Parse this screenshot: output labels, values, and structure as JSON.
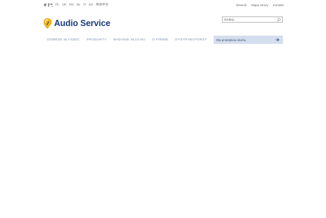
{
  "languages": [
    "PL",
    "UK",
    "EN",
    "NL",
    "IT",
    "ES",
    "简体中文"
  ],
  "util_links": {
    "slownik": "Słownik",
    "mapa": "Mapa strony",
    "kontakt": "Kontakt"
  },
  "logo": {
    "text": "Audio Service"
  },
  "search": {
    "placeholder": "Szukaj..."
  },
  "nav": {
    "items": [
      "DOBRZE SŁYSZEĆ",
      "PRODUKTY",
      "BADANIE SŁUCHU",
      "O FIRMIE",
      "DYSTRYBUTORZY"
    ]
  },
  "test_button": {
    "label": "Dla protetyków słuchu"
  },
  "colors": {
    "brand_blue": "#1b3d7a",
    "logo_yellow": "#f2b21c",
    "nav_text": "#7a8fad",
    "button_bg": "#d4deee"
  }
}
